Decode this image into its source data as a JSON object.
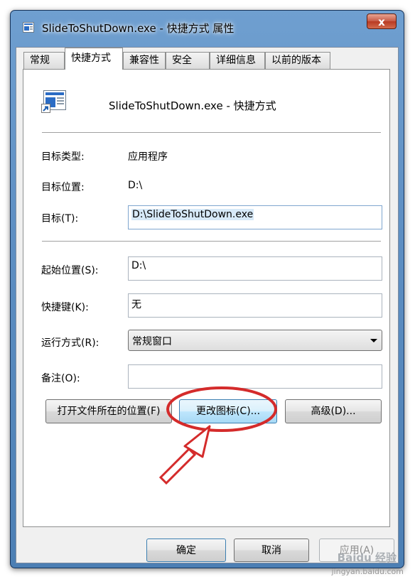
{
  "window": {
    "title": "SlideToShutDown.exe - 快捷方式 属性",
    "close_label": "x"
  },
  "tabs": [
    {
      "label": "常规"
    },
    {
      "label": "快捷方式",
      "active": true
    },
    {
      "label": "兼容性"
    },
    {
      "label": "安全"
    },
    {
      "label": "详细信息"
    },
    {
      "label": "以前的版本"
    }
  ],
  "shortcut": {
    "name": "SlideToShutDown.exe - 快捷方式",
    "target_type_label": "目标类型:",
    "target_type_value": "应用程序",
    "target_location_label": "目标位置:",
    "target_location_value": "D:\\",
    "target_label": "目标(T):",
    "target_value": "D:\\SlideToShutDown.exe",
    "start_in_label": "起始位置(S):",
    "start_in_value": "D:\\",
    "hotkey_label": "快捷键(K):",
    "hotkey_value": "无",
    "run_label": "运行方式(R):",
    "run_value": "常规窗口",
    "comment_label": "备注(O):",
    "comment_value": ""
  },
  "buttons": {
    "open_location": "打开文件所在的位置(F)",
    "change_icon": "更改图标(C)...",
    "advanced": "高级(D)...",
    "ok": "确定",
    "cancel": "取消",
    "apply": "应用(A)"
  },
  "watermark": {
    "logo": "Baidu 经验",
    "url": "jingyan.baidu.com"
  },
  "colors": {
    "annotation": "#d42b2b",
    "selection": "#d7e9f8"
  }
}
